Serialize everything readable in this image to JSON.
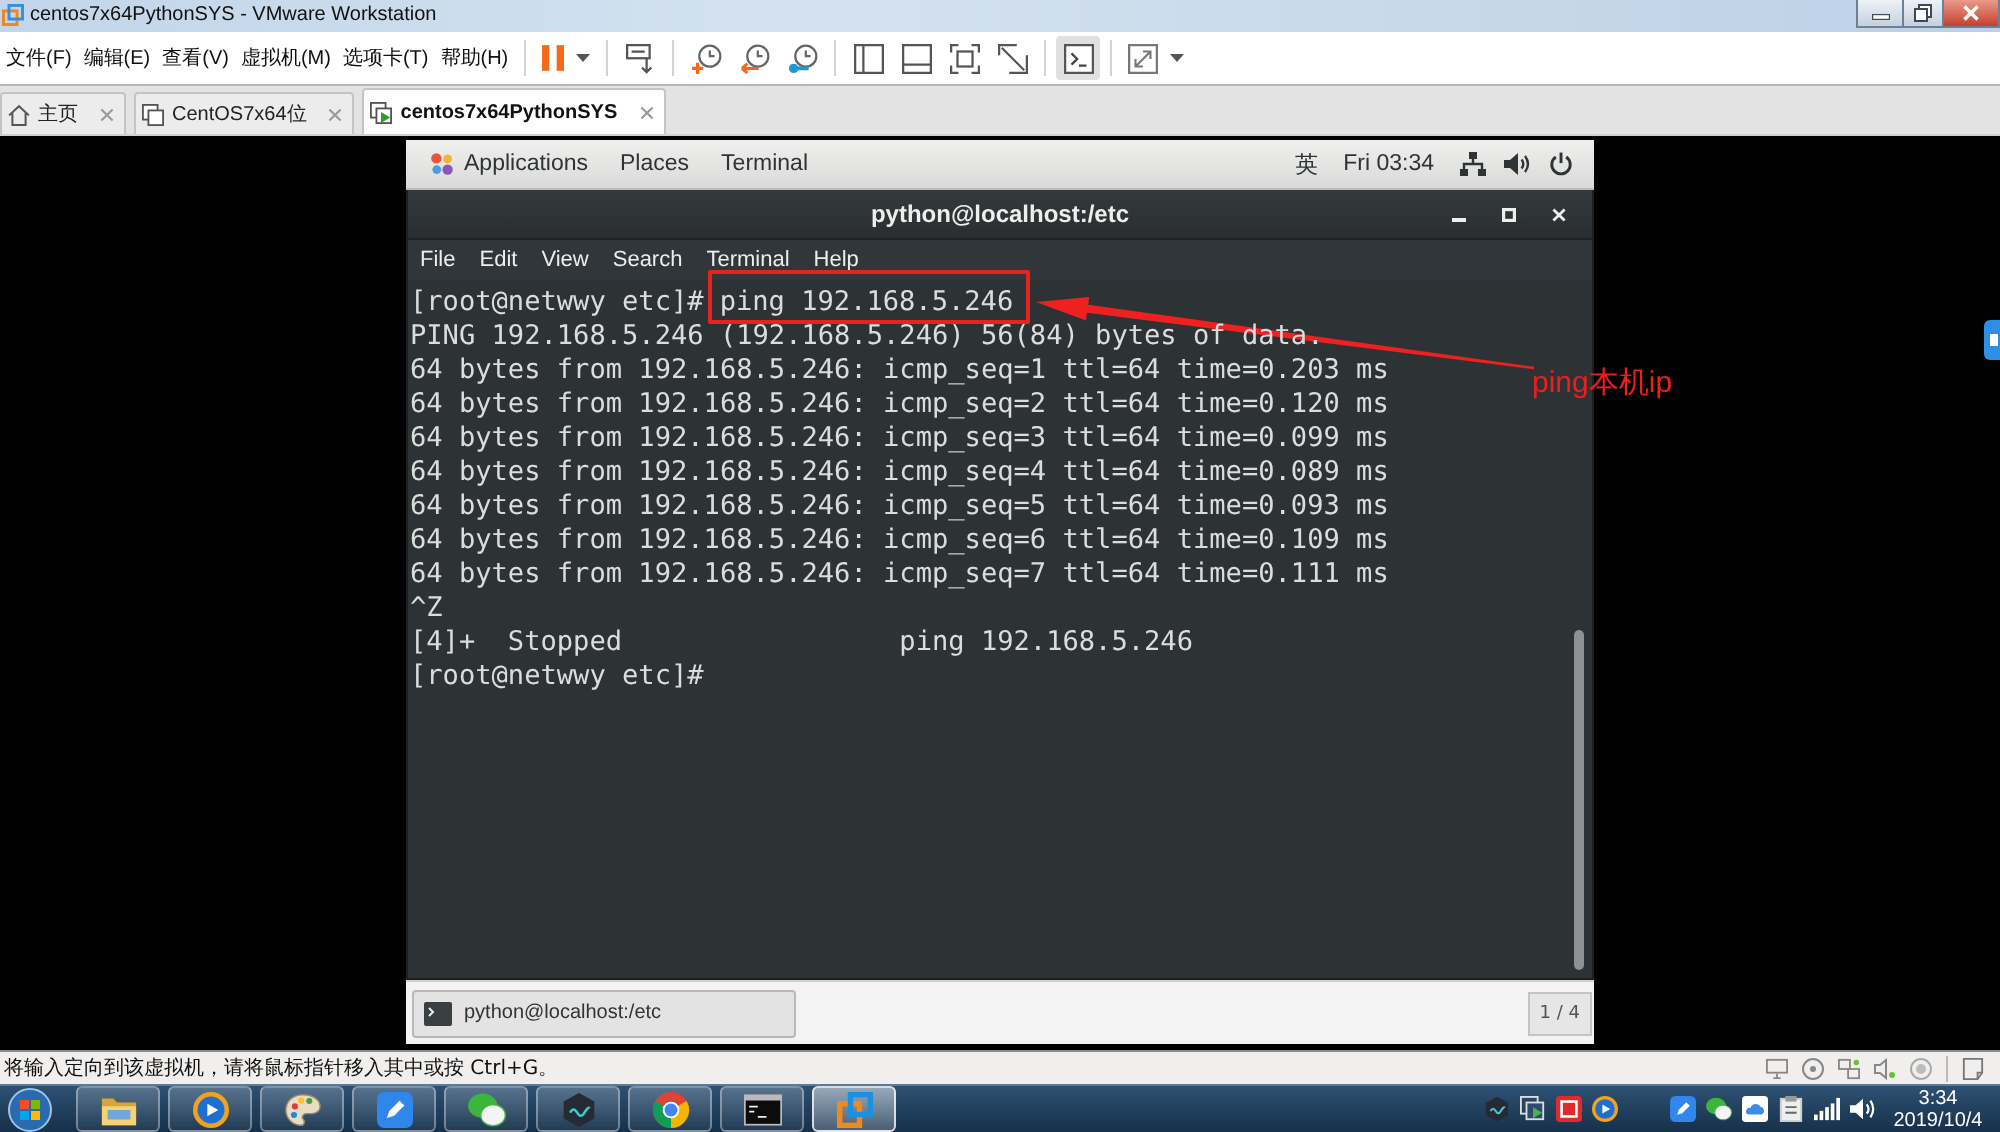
{
  "window": {
    "title": "centos7x64PythonSYS - VMware Workstation"
  },
  "menu": [
    "文件(F)",
    "编辑(E)",
    "查看(V)",
    "虚拟机(M)",
    "选项卡(T)",
    "帮助(H)"
  ],
  "toolbar": [
    [
      {
        "kind": "pause",
        "selected": false
      }
    ],
    [
      {
        "kind": "send-keys",
        "selected": false
      }
    ],
    [
      {
        "kind": "snapshot",
        "selected": false
      },
      {
        "kind": "revert",
        "selected": false
      },
      {
        "kind": "snapshot-manager",
        "selected": false
      }
    ],
    [
      {
        "kind": "library",
        "selected": false
      },
      {
        "kind": "thumbnails",
        "selected": false
      },
      {
        "kind": "fit",
        "selected": false
      },
      {
        "kind": "unity",
        "selected": false
      }
    ],
    [
      {
        "kind": "console",
        "selected": true
      }
    ],
    [
      {
        "kind": "fullscreen",
        "selected": false
      }
    ]
  ],
  "tabs": [
    {
      "kind": "home",
      "label": "主页",
      "selected": false
    },
    {
      "kind": "vm",
      "label": "CentOS7x64位",
      "selected": false
    },
    {
      "kind": "vm-running",
      "label": "centos7x64PythonSYS",
      "selected": true
    }
  ],
  "guest": {
    "top_bar": {
      "menus": [
        {
          "kind": "apps",
          "label": "Applications"
        },
        {
          "kind": "plain",
          "label": "Places"
        },
        {
          "kind": "plain",
          "label": "Terminal"
        }
      ],
      "input_method": "英",
      "clock": "Fri 03:34"
    },
    "terminal": {
      "title": "python@localhost:/etc",
      "menu": [
        "File",
        "Edit",
        "View",
        "Search",
        "Terminal",
        "Help"
      ],
      "lines": [
        {
          "kind": "prompt",
          "prompt": "[root@netwwy etc]#",
          "command": "ping 192.168.5.246",
          "highlighted": true
        },
        {
          "kind": "output",
          "text": "PING 192.168.5.246 (192.168.5.246) 56(84) bytes of data."
        },
        {
          "kind": "output",
          "text": "64 bytes from 192.168.5.246: icmp_seq=1 ttl=64 time=0.203 ms"
        },
        {
          "kind": "output",
          "text": "64 bytes from 192.168.5.246: icmp_seq=2 ttl=64 time=0.120 ms"
        },
        {
          "kind": "output",
          "text": "64 bytes from 192.168.5.246: icmp_seq=3 ttl=64 time=0.099 ms"
        },
        {
          "kind": "output",
          "text": "64 bytes from 192.168.5.246: icmp_seq=4 ttl=64 time=0.089 ms"
        },
        {
          "kind": "output",
          "text": "64 bytes from 192.168.5.246: icmp_seq=5 ttl=64 time=0.093 ms"
        },
        {
          "kind": "output",
          "text": "64 bytes from 192.168.5.246: icmp_seq=6 ttl=64 time=0.109 ms"
        },
        {
          "kind": "output",
          "text": "64 bytes from 192.168.5.246: icmp_seq=7 ttl=64 time=0.111 ms"
        },
        {
          "kind": "output",
          "text": "^Z"
        },
        {
          "kind": "output",
          "text": "[4]+  Stopped                 ping 192.168.5.246"
        },
        {
          "kind": "prompt",
          "prompt": "[root@netwwy etc]#"
        }
      ]
    },
    "bottom_bar": {
      "tasks": [
        {
          "label": "python@localhost:/etc",
          "selected": true
        }
      ],
      "workspace": "1 / 4"
    }
  },
  "annotation": {
    "label": "ping本机ip"
  },
  "status_bar": {
    "message": "将输入定向到该虚拟机，请将鼠标指针移入其中或按 Ctrl+G。"
  },
  "taskbar": {
    "apps": [
      {
        "kind": "folder",
        "selected": false
      },
      {
        "kind": "player",
        "selected": false
      },
      {
        "kind": "paint",
        "selected": false
      },
      {
        "kind": "pen",
        "selected": false
      },
      {
        "kind": "chat",
        "selected": false
      },
      {
        "kind": "emulator",
        "selected": false
      },
      {
        "kind": "browser",
        "selected": false
      },
      {
        "kind": "console",
        "selected": false
      },
      {
        "kind": "vm",
        "selected": true
      }
    ],
    "time": "3:34",
    "date": "2019/10/4"
  }
}
